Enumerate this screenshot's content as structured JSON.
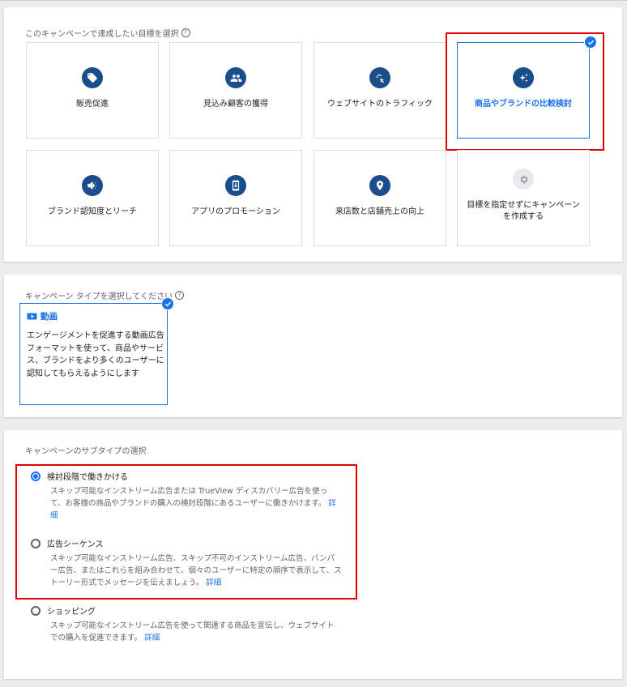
{
  "goal_section": {
    "title": "このキャンペーンで達成したい目標を選択",
    "help_icon": "help-circle-icon",
    "goals": [
      {
        "label": "販売促進",
        "icon": "sell-tag-icon",
        "selected": false
      },
      {
        "label": "見込み顧客の獲得",
        "icon": "people-icon",
        "selected": false
      },
      {
        "label": "ウェブサイトのトラフィック",
        "icon": "cursor-click-icon",
        "selected": false
      },
      {
        "label": "商品やブランドの比較検討",
        "icon": "sparkle-icon",
        "selected": true
      },
      {
        "label": "ブランド認知度とリーチ",
        "icon": "megaphone-icon",
        "selected": false
      },
      {
        "label": "アプリのプロモーション",
        "icon": "phone-download-icon",
        "selected": false
      },
      {
        "label": "来店数と店舗売上の向上",
        "icon": "location-pin-icon",
        "selected": false
      },
      {
        "label": "目標を指定せずにキャンペーンを作成する",
        "icon": "gear-icon",
        "selected": false
      }
    ]
  },
  "type_section": {
    "title": "キャンペーン タイプを選択してください",
    "selected_type": {
      "icon": "video-camera-icon",
      "title": "動画",
      "description": "エンゲージメントを促進する動画広告フォーマットを使って、商品やサービス、ブランドをより多くのユーザーに認知してもらえるようにします"
    }
  },
  "subtype_section": {
    "title": "キャンペーンのサブタイプの選択",
    "options": [
      {
        "label": "検討段階で働きかける",
        "selected": true,
        "description": "スキップ可能なインストリーム広告または TrueView ディスカバリー広告を使って、お客様の商品やブランドの購入の検討段階にあるユーザーに働きかけます。",
        "link": "詳細"
      },
      {
        "label": "広告シーケンス",
        "selected": false,
        "description": "スキップ可能なインストリーム広告、スキップ不可のインストリーム広告、バンパー広告、またはこれらを組み合わせて、個々のユーザーに特定の順序で表示して、ストーリー形式でメッセージを伝えましょう。",
        "link": "詳細"
      },
      {
        "label": "ショッピング",
        "selected": false,
        "description": "スキップ可能なインストリーム広告を使って関連する商品を宣伝し、ウェブサイトでの購入を促進できます。",
        "link": "詳細"
      }
    ]
  },
  "colors": {
    "accent": "#1a73e8",
    "icon_bg": "#1a4d8c",
    "highlight_red": "#e00000"
  }
}
